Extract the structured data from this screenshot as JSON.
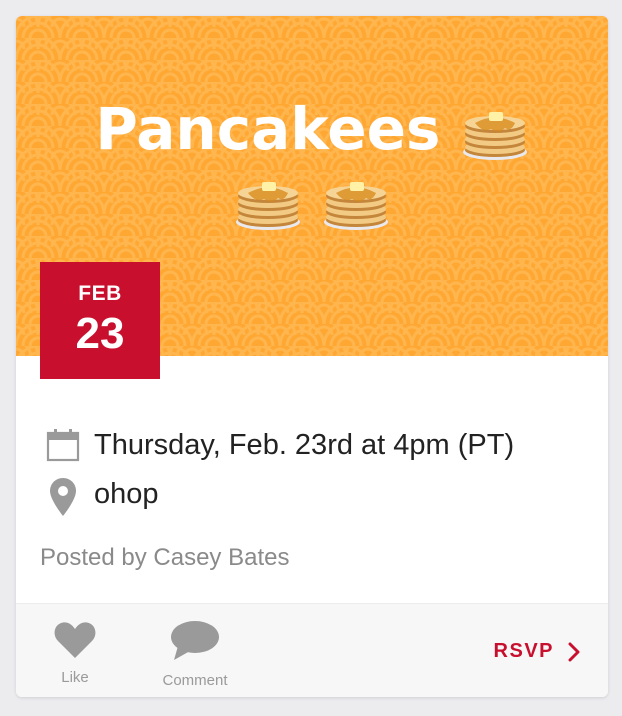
{
  "event": {
    "title_line1": "Pancakees",
    "pancake_emoji": "pancakes-emoji",
    "pancake_count_line1": 1,
    "pancake_count_line2": 2,
    "date_month": "FEB",
    "date_day": "23",
    "datetime": "Thursday, Feb. 23rd at 4pm (PT)",
    "location": "ohop",
    "posted_by": "Posted by Casey Bates"
  },
  "actions": {
    "like_label": "Like",
    "comment_label": "Comment",
    "rsvp_label": "RSVP"
  },
  "icons": {
    "calendar": "calendar-icon",
    "location": "location-pin-icon",
    "like": "heart-icon",
    "comment": "speech-bubble-icon",
    "rsvp": "chevron-right-icon"
  },
  "colors": {
    "hero_bg": "#ffa733",
    "brand_red": "#c8102e",
    "muted_text": "#8a8a8a",
    "icon_gray": "#9a9a9a"
  }
}
